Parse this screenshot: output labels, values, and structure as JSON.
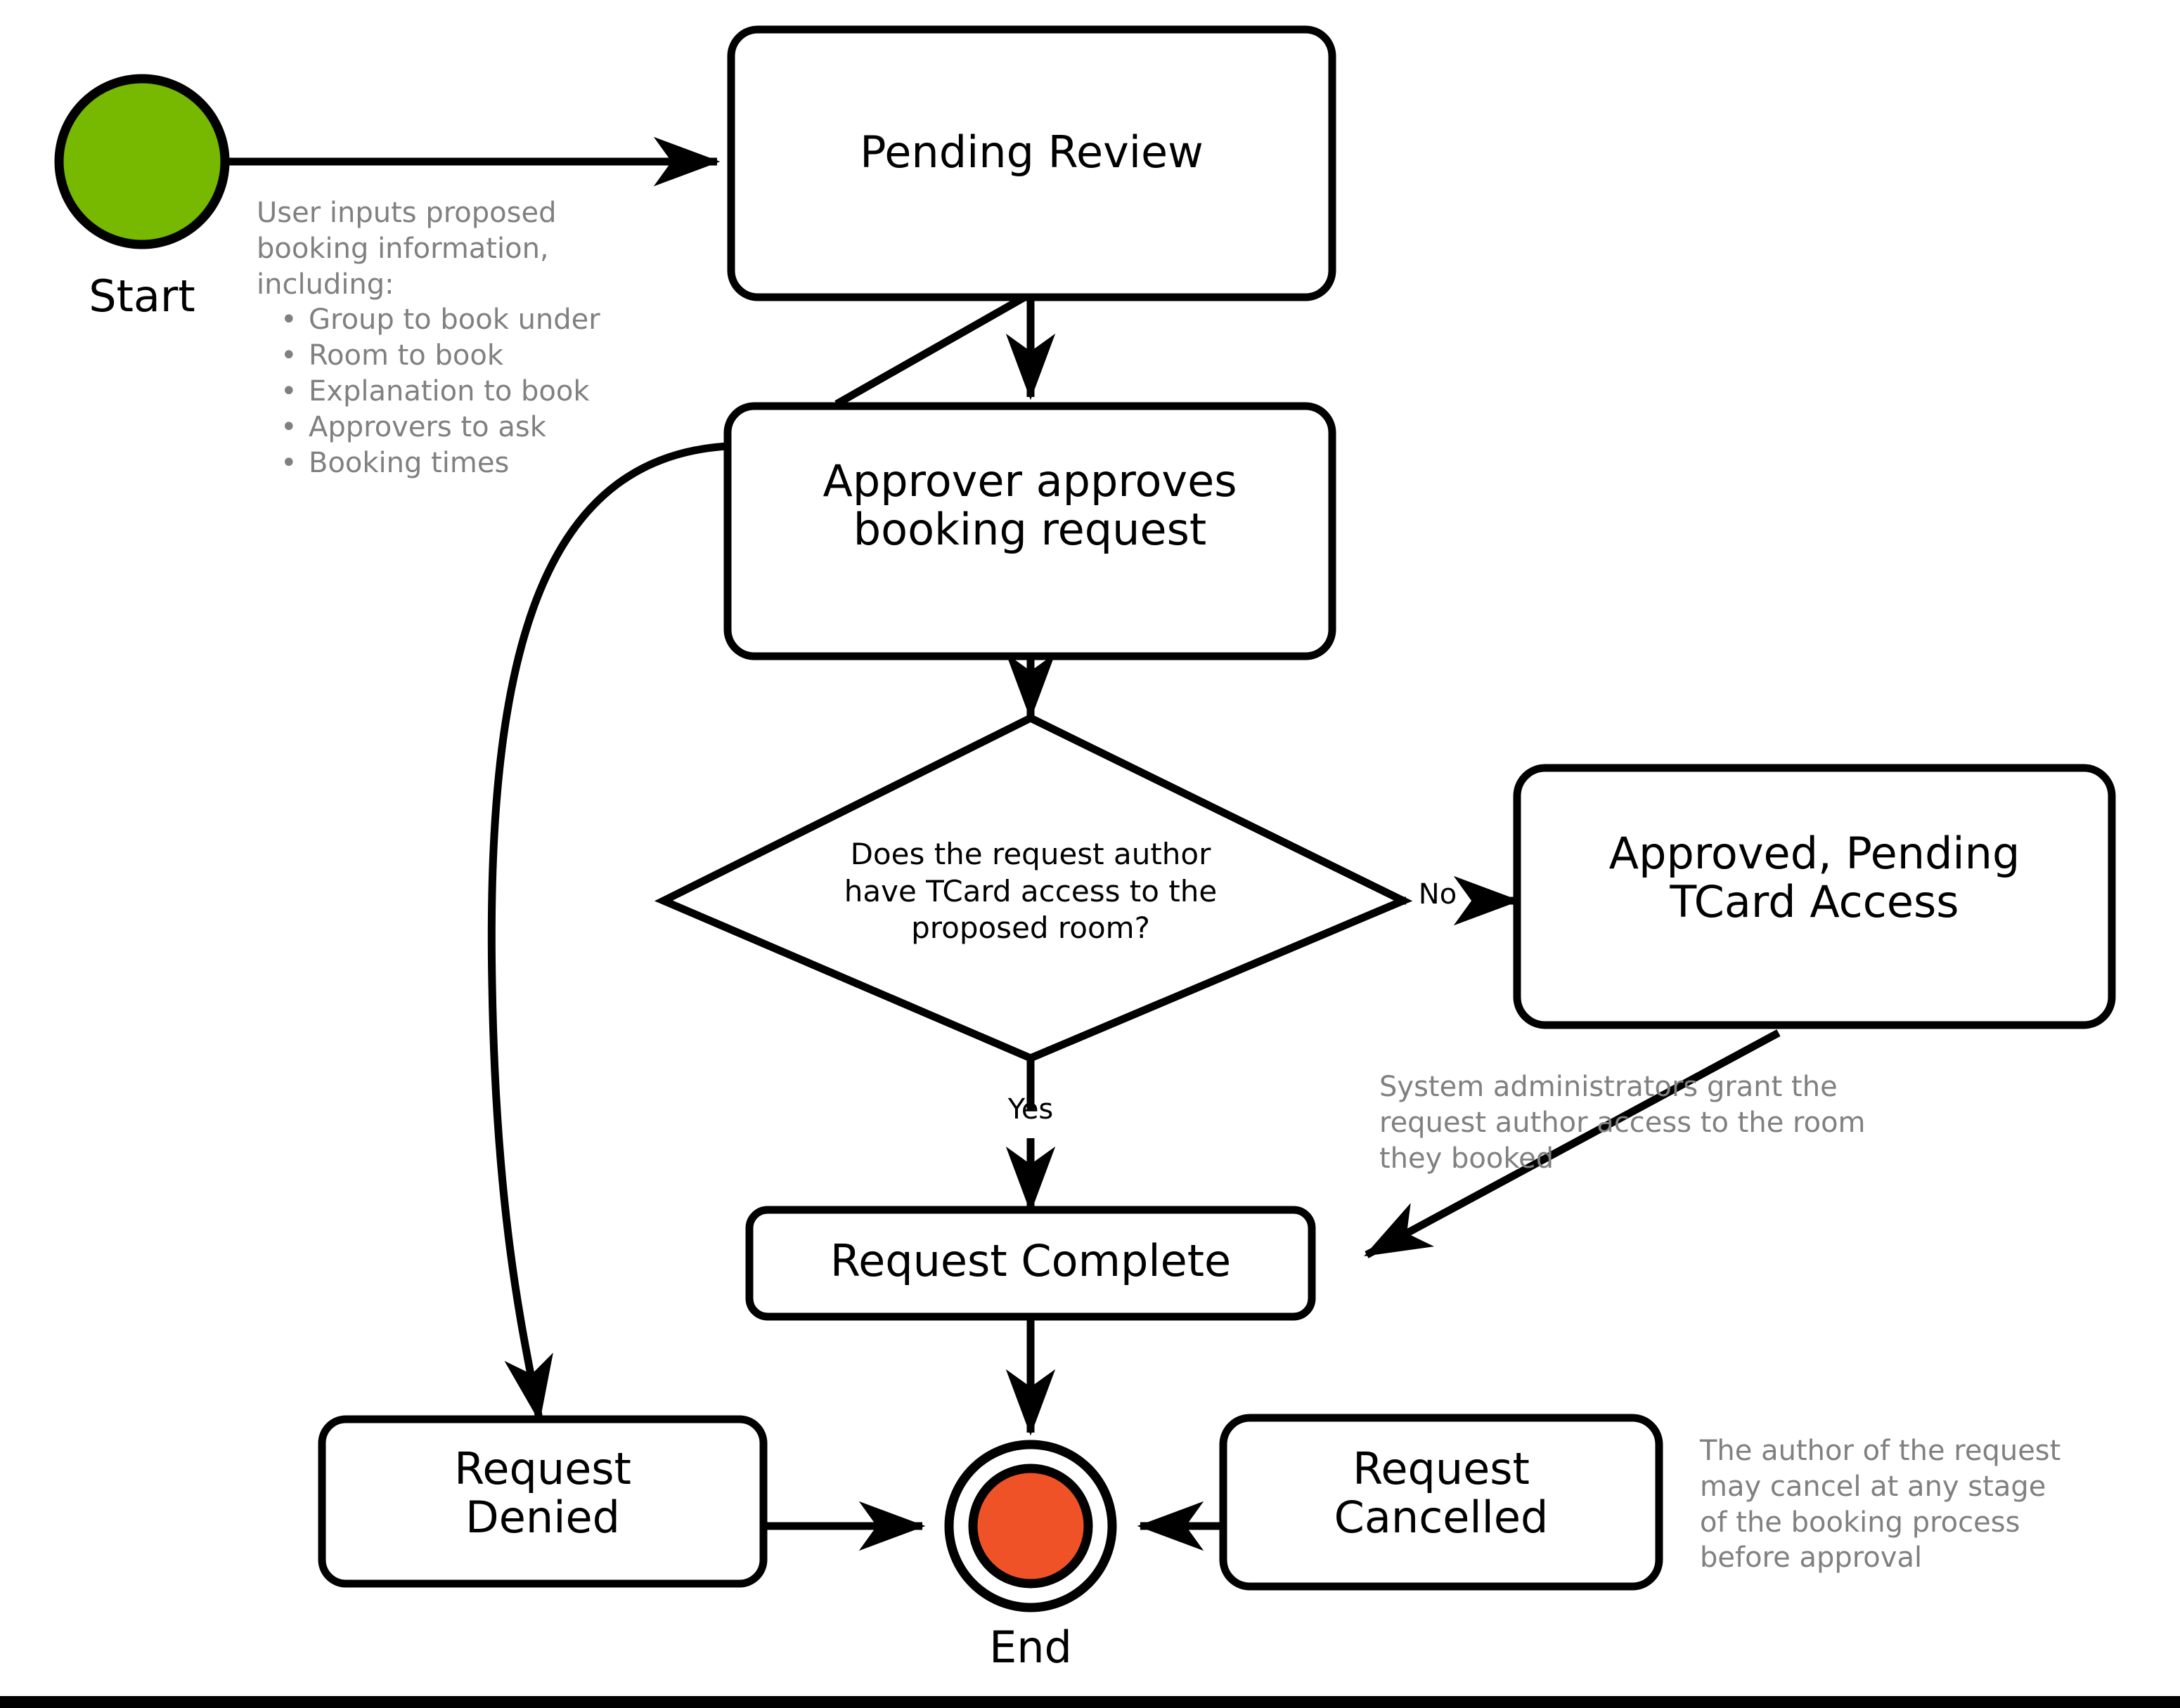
{
  "diagram": {
    "title": "Room Booking Request Workflow",
    "colors": {
      "start_fill": "#76b900",
      "end_fill": "#f05227",
      "node_stroke": "#000000",
      "node_fill": "#ffffff",
      "annotation_text": "#808080",
      "label_text": "#000000",
      "background": "#ffffff"
    },
    "nodes": {
      "start": {
        "label": "Start",
        "shape": "circle",
        "fill": "#76b900"
      },
      "pending_review": {
        "label": "Pending Review",
        "shape": "rounded-rect"
      },
      "approver_approves": {
        "label": "Approver approves\nbooking request",
        "shape": "rounded-rect"
      },
      "decision_tcard": {
        "label": "Does the request author\nhave TCard access to the\nproposed room?",
        "shape": "diamond"
      },
      "approved_pending_tcard": {
        "label": "Approved, Pending\nTCard Access",
        "shape": "rounded-rect"
      },
      "request_complete": {
        "label": "Request Complete",
        "shape": "rounded-rect"
      },
      "request_denied": {
        "label": "Request\nDenied",
        "shape": "rounded-rect"
      },
      "request_cancelled": {
        "label": "Request\nCancelled",
        "shape": "rounded-rect"
      },
      "end": {
        "label": "End",
        "shape": "double-circle",
        "fill": "#f05227"
      }
    },
    "edge_labels": {
      "no": "No",
      "yes": "Yes"
    },
    "annotations": {
      "start_inputs": {
        "intro_lines": "User inputs proposed\nbooking information,\nincluding:",
        "bullets": [
          "Group to book under",
          "Room to book",
          "Explanation to book",
          "Approvers to ask",
          "Booking times"
        ]
      },
      "tcard_grant": "System administrators grant the\nrequest author access to the room\nthey booked",
      "cancel_note": "The author of the request\nmay cancel at any stage\nof the booking process\nbefore approval"
    }
  }
}
